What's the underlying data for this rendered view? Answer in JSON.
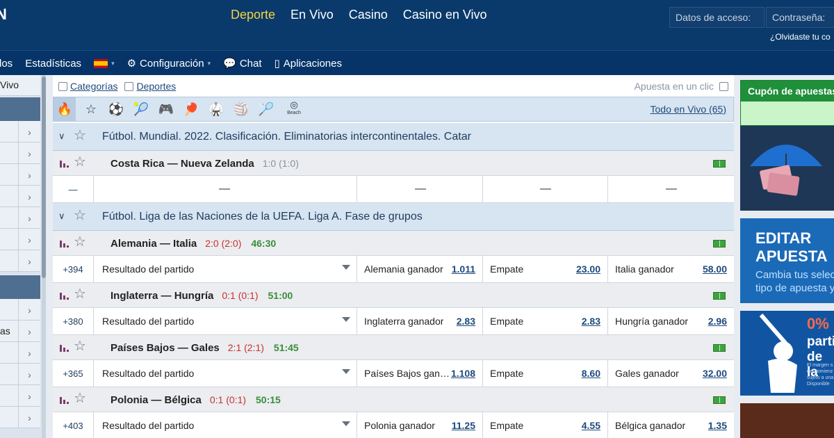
{
  "header": {
    "logo": "N",
    "nav": [
      "Deporte",
      "En Vivo",
      "Casino",
      "Casino en Vivo"
    ],
    "login_label": "Datos de acceso:",
    "password_label": "Contraseña:",
    "forgot": "¿Olvidaste tu co"
  },
  "subnav": {
    "results": "dos",
    "stats": "Estadísticas",
    "config": "Configuración",
    "chat": "Chat",
    "apps": "Aplicaciones"
  },
  "sidebar": {
    "live": "Vivo",
    "row_text": "as"
  },
  "filters": {
    "categories": "Categorías",
    "sports": "Deportes",
    "one_click": "Apuesta en un clic",
    "all_live": "Todo en Vivo (65)",
    "beach": "Beach"
  },
  "leagues": [
    {
      "title": "Fútbol. Mundial. 2022. Clasificación. Eliminatorias intercontinentales. Catar"
    },
    {
      "title": "Fútbol. Liga de las Naciones de la UEFA. Liga A. Fase de grupos"
    }
  ],
  "dash": "—",
  "matches": [
    {
      "teams": "Costa Rica — Nueva Zelanda",
      "score": "1:0 (1:0)",
      "time": ""
    },
    {
      "teams": "Alemania — Italia",
      "score": "2:0 (2:0)",
      "time": "46:30",
      "more": "+394",
      "market": "Resultado del partido",
      "home": "Alemania ganador",
      "home_odd": "1.011",
      "draw": "Empate",
      "draw_odd": "23.00",
      "away": "Italia ganador",
      "away_odd": "58.00"
    },
    {
      "teams": "Inglaterra — Hungría",
      "score": "0:1 (0:1)",
      "time": "51:00",
      "more": "+380",
      "market": "Resultado del partido",
      "home": "Inglaterra ganador",
      "home_odd": "2.83",
      "draw": "Empate",
      "draw_odd": "2.83",
      "away": "Hungría ganador",
      "away_odd": "2.96"
    },
    {
      "teams": "Países Bajos — Gales",
      "score": "2:1 (2:1)",
      "time": "51:45",
      "more": "+365",
      "market": "Resultado del partido",
      "home": "Países Bajos ganador",
      "home_odd": "1.108",
      "draw": "Empate",
      "draw_odd": "8.60",
      "away": "Gales ganador",
      "away_odd": "32.00"
    },
    {
      "teams": "Polonia — Bélgica",
      "score": "0:1 (0:1)",
      "time": "50:15",
      "more": "+403",
      "market": "Resultado del partido",
      "home": "Polonia ganador",
      "home_odd": "11.25",
      "draw": "Empate",
      "draw_odd": "4.55",
      "away": "Bélgica ganador",
      "away_odd": "1.35"
    }
  ],
  "right": {
    "coupon": "Cupón de apuestas",
    "edit_title": "EDITAR APUESTA",
    "edit_sub": "Cambia tus selec tipo de apuesta y",
    "promo_pct": "0%",
    "promo_title": "parti de la",
    "promo_small": "El margen s del comienz sujeto a una Disponible"
  },
  "colors": {
    "header_bg": "#0a3a6b",
    "active_nav": "#f5d33f",
    "live_time": "#3a8c3a",
    "score_red": "#c9302c",
    "coupon_green": "#1f8f3a",
    "odds_link": "#1d4a7d"
  }
}
